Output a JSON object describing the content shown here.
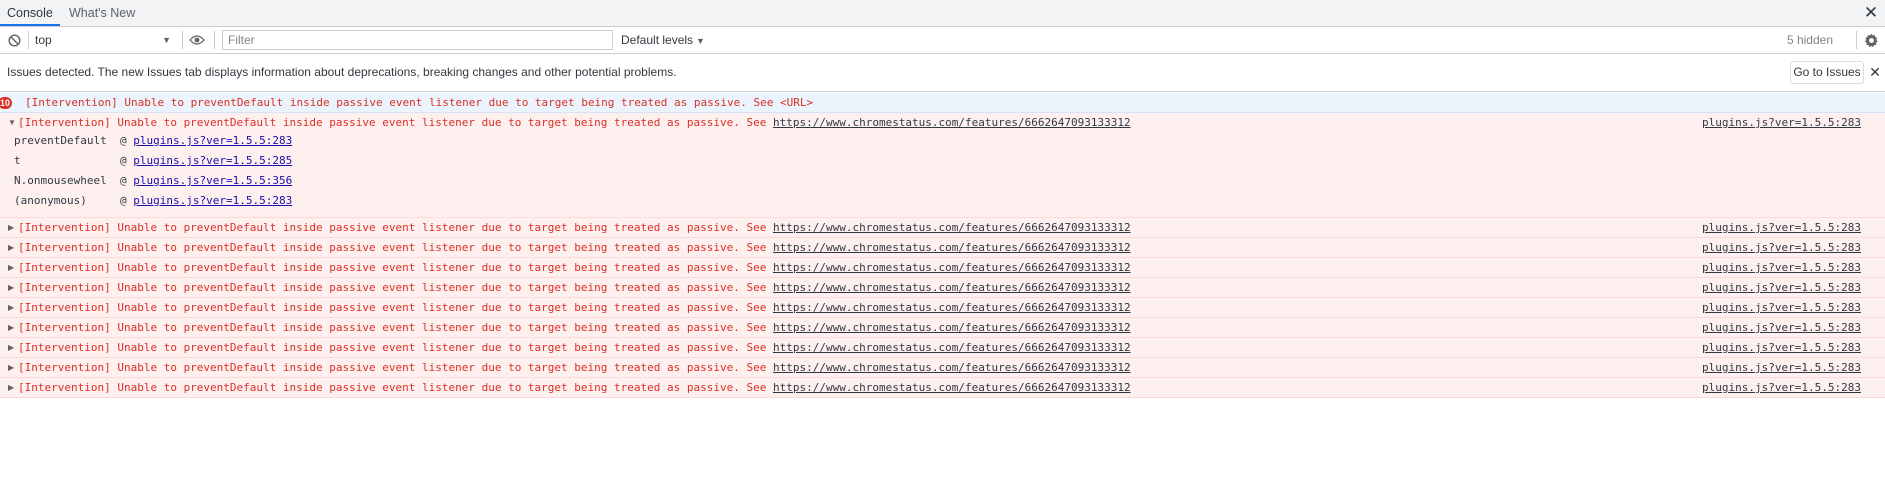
{
  "tabs": [
    {
      "label": "Console"
    },
    {
      "label": "What's New"
    }
  ],
  "toolbar": {
    "context": "top",
    "filter_placeholder": "Filter",
    "levels": "Default levels",
    "hidden": "5 hidden"
  },
  "issues": {
    "text": "Issues detected. The new Issues tab displays information about deprecations, breaking changes and other potential problems.",
    "button": "Go to Issues"
  },
  "summary": {
    "badge": "10",
    "text": "[Intervention] Unable to preventDefault inside passive event listener due to target being treated as passive. See <URL>"
  },
  "message": {
    "text": "[Intervention] Unable to preventDefault inside passive event listener due to target being treated as passive. See ",
    "link": "https://www.chromestatus.com/features/6662647093133312",
    "source": "plugins.js?ver=1.5.5:283"
  },
  "stack_trace": [
    {
      "fn": "preventDefault",
      "loc": "plugins.js?ver=1.5.5:283"
    },
    {
      "fn": "t",
      "loc": "plugins.js?ver=1.5.5:285"
    },
    {
      "fn": "N.onmousewheel",
      "loc": "plugins.js?ver=1.5.5:356"
    },
    {
      "fn": "(anonymous)",
      "loc": "plugins.js?ver=1.5.5:283"
    }
  ],
  "colors": {
    "error_text": "#d93025",
    "error_bg": "#fff0f0",
    "info_bg": "#ebf3fd",
    "accent": "#1a73e8"
  }
}
